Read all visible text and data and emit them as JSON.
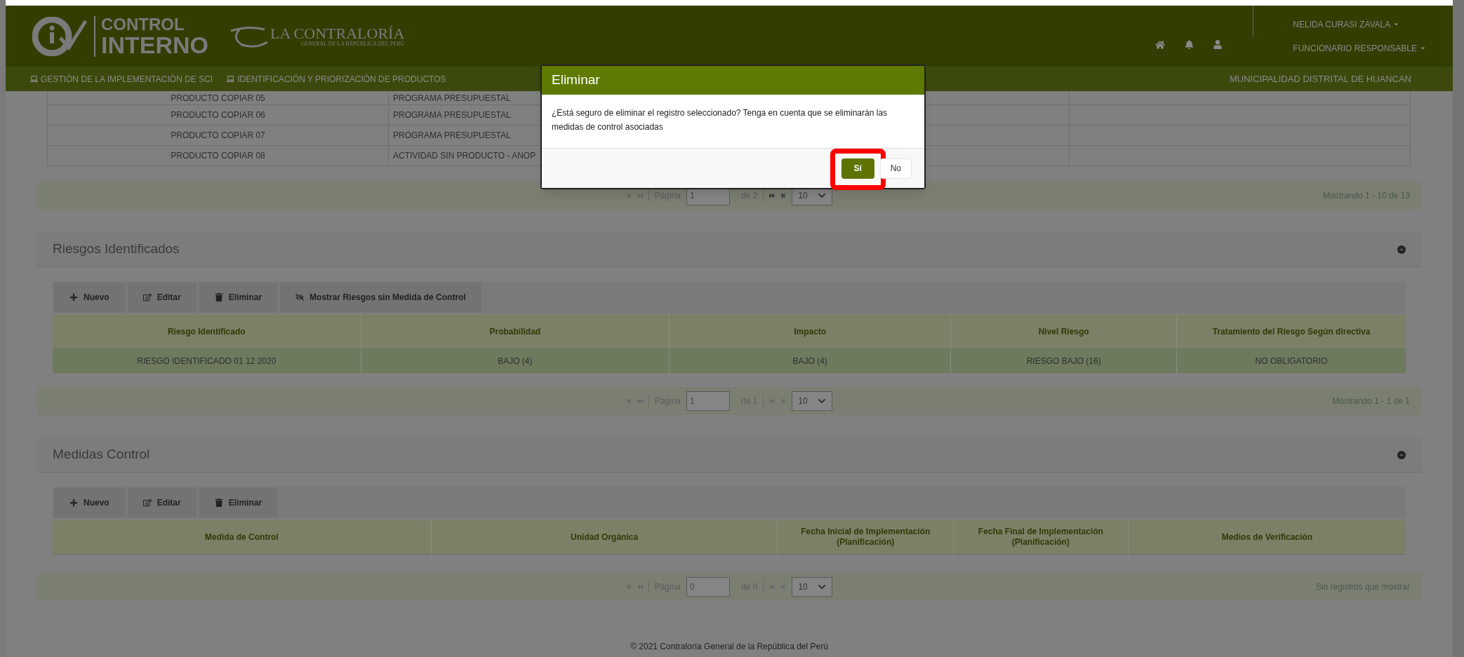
{
  "header": {
    "logo_line_1": "CONTROL",
    "logo_line_2": "INTERNO",
    "org_name": "LA CONTRALORÍA",
    "org_subtitle": "GENERAL DE LA REPÚBLICA DEL PERÚ",
    "user_name": "NELIDA CURASI ZAVALA",
    "user_role": "FUNCIONARIO RESPONSABLE"
  },
  "nav": {
    "items": [
      "GESTIÓN DE LA IMPLEMENTACIÓN DE SCI",
      "IDENTIFICACIÓN Y PRIORIZACIÓN DE PRODUCTOS"
    ],
    "entity": "MUNICIPALIDAD DISTRITAL DE HUANCAN"
  },
  "products_table": {
    "rows": [
      {
        "column_1": "PRODUCTO COPIAR 05",
        "column_2": "PROGRAMA PRESUPUESTAL"
      },
      {
        "column_1": "PRODUCTO COPIAR 06",
        "column_2": "PROGRAMA PRESUPUESTAL"
      },
      {
        "column_1": "PRODUCTO COPIAR 07",
        "column_2": "PROGRAMA PRESUPUESTAL"
      },
      {
        "column_1": "PRODUCTO COPIAR 08",
        "column_2": "ACTIVIDAD SIN PRODUCTO - ANOP"
      }
    ],
    "pager": {
      "label": "Página",
      "page": "1",
      "of": "de 2",
      "page_size": "10",
      "summary": "Mostrando 1 - 10 de 13",
      "next_enabled": true
    }
  },
  "sections": [
    {
      "title": "Riesgos Identificados",
      "toolbar": [
        {
          "kind": "add",
          "label": "Nuevo"
        },
        {
          "kind": "edit",
          "label": "Editar"
        },
        {
          "kind": "delete",
          "label": "Eliminar"
        },
        {
          "kind": "hide",
          "label": "Mostrar Riesgos sin Medida de Control"
        }
      ],
      "columns": [
        "Riesgo Identificado",
        "Probabilidad",
        "Impacto",
        "Nivel Riesgo",
        "Tratamiento del Riesgo Según directiva"
      ],
      "rows": [
        {
          "selected": true,
          "cells": [
            "RIESGO IDENTIFICADO 01 12 2020",
            "BAJO (4)",
            "BAJO (4)",
            "RIESGO BAJO (16)",
            "NO OBLIGATORIO"
          ]
        }
      ],
      "pager": {
        "label": "Página",
        "page": "1",
        "of": "de 1",
        "page_size": "10",
        "summary": "Mostrando 1 - 1 de 1",
        "next_enabled": false
      }
    },
    {
      "title": "Medidas Control",
      "toolbar": [
        {
          "kind": "add",
          "label": "Nuevo"
        },
        {
          "kind": "edit",
          "label": "Editar"
        },
        {
          "kind": "delete",
          "label": "Eliminar"
        }
      ],
      "columns": [
        "Medida de Control",
        "Unidad Orgánica",
        "Fecha Inicial de Implementación (Planificación)",
        "Fecha Final de Implementación (Planificación)",
        "Medios de Verificación"
      ],
      "pager": {
        "label": "Página",
        "page": "0",
        "of": "de 0",
        "page_size": "10",
        "summary": "Sin registros que mostrar",
        "next_enabled": false
      }
    }
  ],
  "footer": "© 2021 Contraloría General de la República del Perú",
  "dialog": {
    "title": "Eliminar",
    "message": "¿Está seguro de eliminar el registro seleccionado? Tenga en cuenta que se eliminarán las medidas de control asociadas",
    "buttons": [
      {
        "label": "Sí",
        "primary": true,
        "highlighted": true
      },
      {
        "label": "No",
        "primary": false,
        "highlighted": false
      }
    ]
  }
}
